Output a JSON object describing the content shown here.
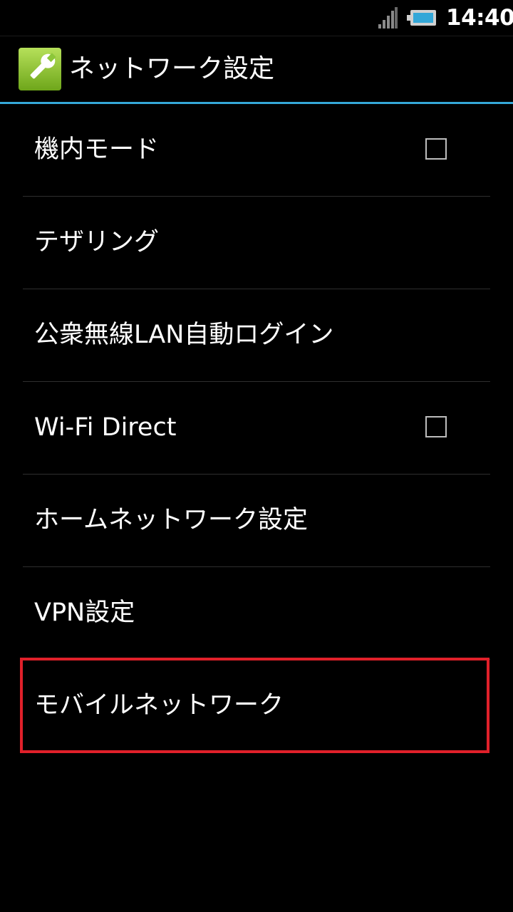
{
  "status_bar": {
    "time": "14:40",
    "signal_icon": "signal-strength-icon",
    "battery_icon": "battery-icon",
    "battery_color": "#33a7d8"
  },
  "title_bar": {
    "icon": "wrench-icon",
    "title": "ネットワーク設定",
    "accent_color": "#35a8d8"
  },
  "items": [
    {
      "label": "機内モード",
      "checkbox": true,
      "checked": false
    },
    {
      "label": "テザリング",
      "checkbox": false
    },
    {
      "label": "公衆無線LAN自動ログイン",
      "checkbox": false
    },
    {
      "label": "Wi-Fi Direct",
      "checkbox": true,
      "checked": false
    },
    {
      "label": "ホームネットワーク設定",
      "checkbox": false
    },
    {
      "label": "VPN設定",
      "checkbox": false
    },
    {
      "label": "モバイルネットワーク",
      "checkbox": false,
      "highlighted": true
    }
  ],
  "highlight_color": "#e0202a"
}
